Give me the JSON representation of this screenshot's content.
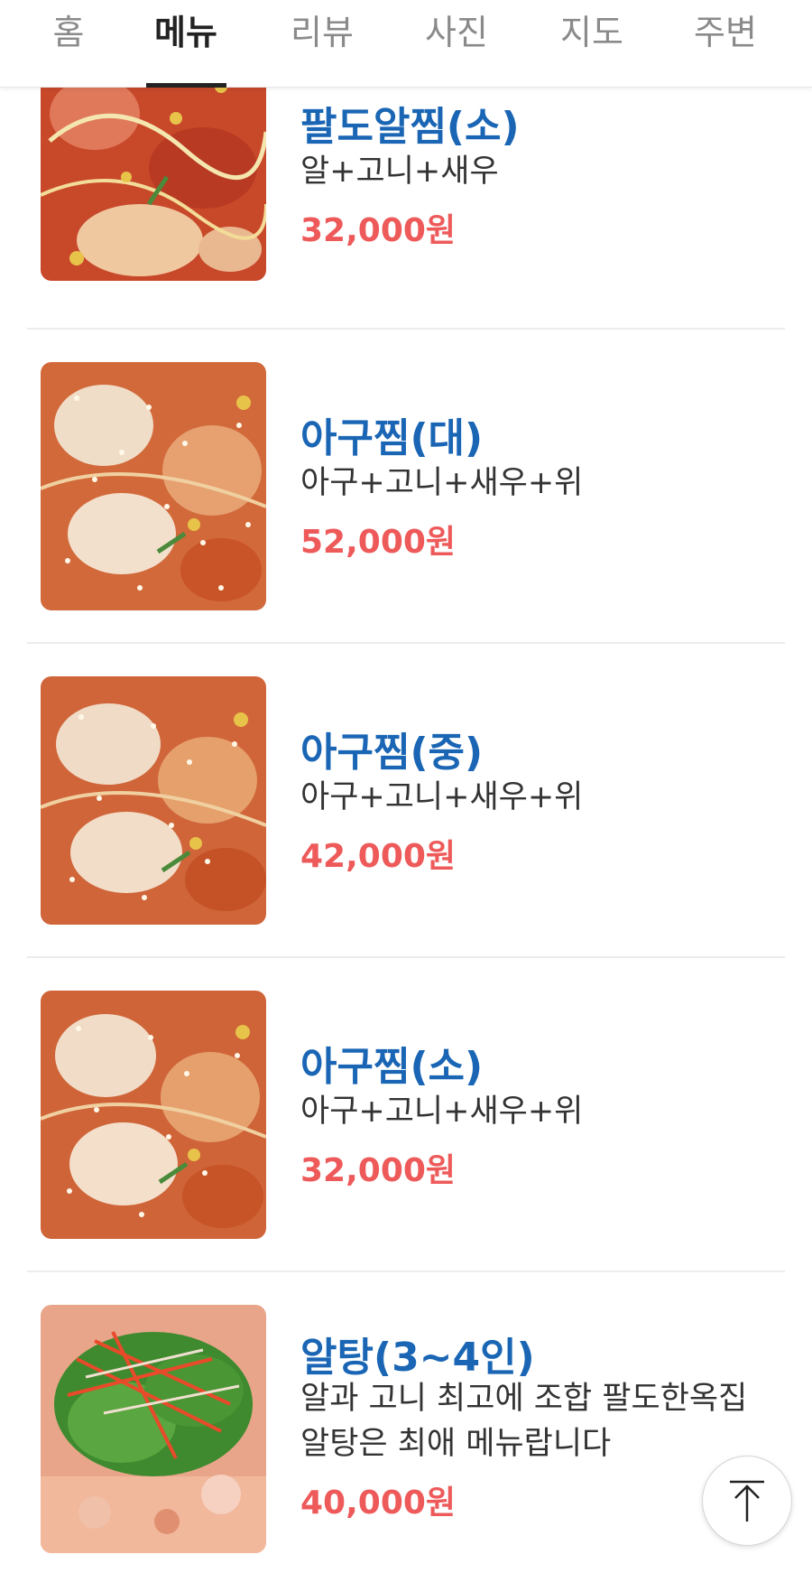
{
  "tabs": [
    {
      "label": "홈",
      "active": false
    },
    {
      "label": "메뉴",
      "active": true
    },
    {
      "label": "리뷰",
      "active": false
    },
    {
      "label": "사진",
      "active": false
    },
    {
      "label": "지도",
      "active": false
    },
    {
      "label": "주변",
      "active": false
    }
  ],
  "menu": {
    "items": [
      {
        "name": "팔도알찜(소)",
        "desc": "알+고니+새우",
        "price": "32,000원"
      },
      {
        "name": "아구찜(대)",
        "desc": "아구+고니+새우+위",
        "price": "52,000원"
      },
      {
        "name": "아구찜(중)",
        "desc": "아구+고니+새우+위",
        "price": "42,000원"
      },
      {
        "name": "아구찜(소)",
        "desc": "아구+고니+새우+위",
        "price": "32,000원"
      },
      {
        "name": "알탕(3~4인)",
        "desc_line1": "알과 고니 최고에 조합 팔도한옥집",
        "desc_line2": "알탕은 최애 메뉴랍니다",
        "price": "40,000원"
      }
    ]
  },
  "icons": {
    "scroll_top": "arrow-up-icon"
  },
  "colors": {
    "name": "#1a66b5",
    "price": "#ee5a5a",
    "active_tab": "#222222",
    "inactive_tab": "#8a8a8a"
  }
}
